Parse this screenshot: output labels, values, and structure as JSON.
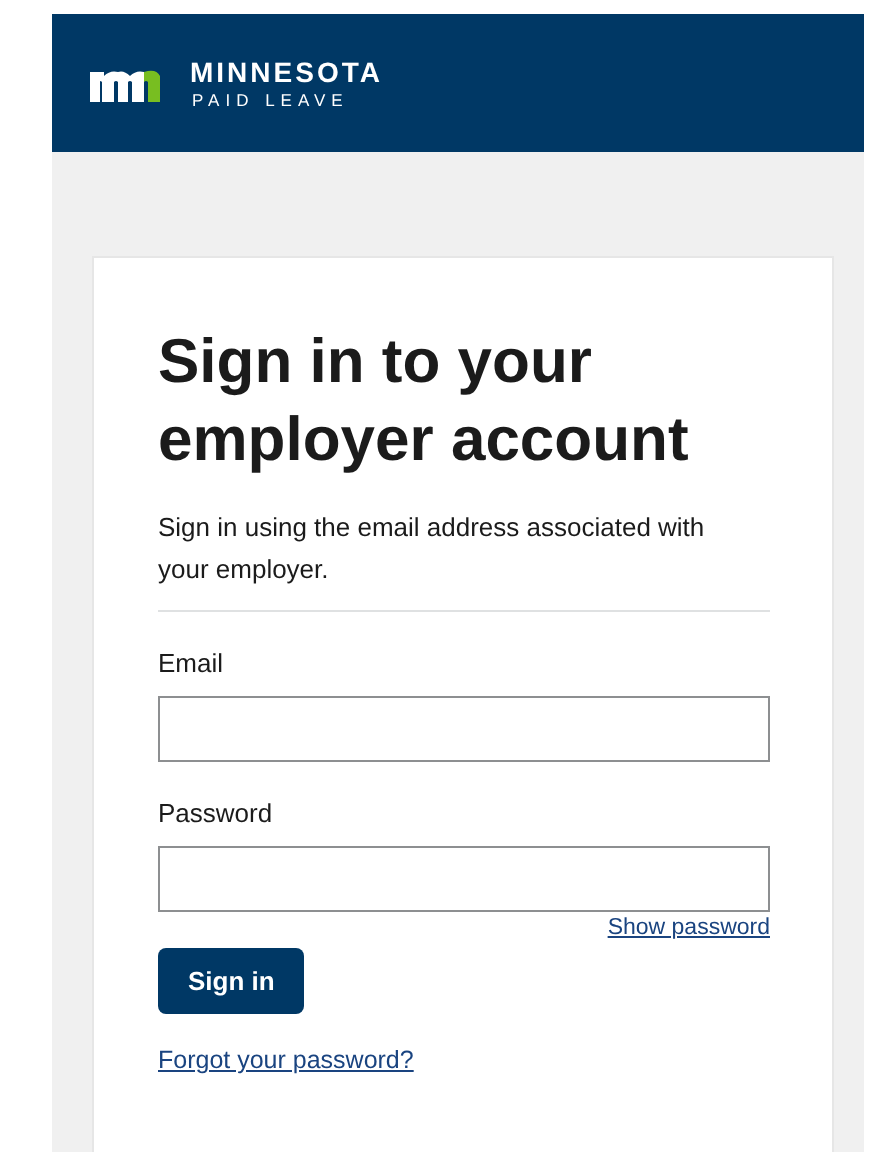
{
  "header": {
    "brand": "MINNESOTA",
    "subbrand": "PAID LEAVE"
  },
  "form": {
    "title": "Sign in to your employer account",
    "intro": "Sign in using the email address associated with your employer.",
    "fields": [
      {
        "label": "Email"
      },
      {
        "label": "Password",
        "toggle": "Show password"
      }
    ],
    "submit": "Sign in",
    "forgot": "Forgot your password?"
  }
}
